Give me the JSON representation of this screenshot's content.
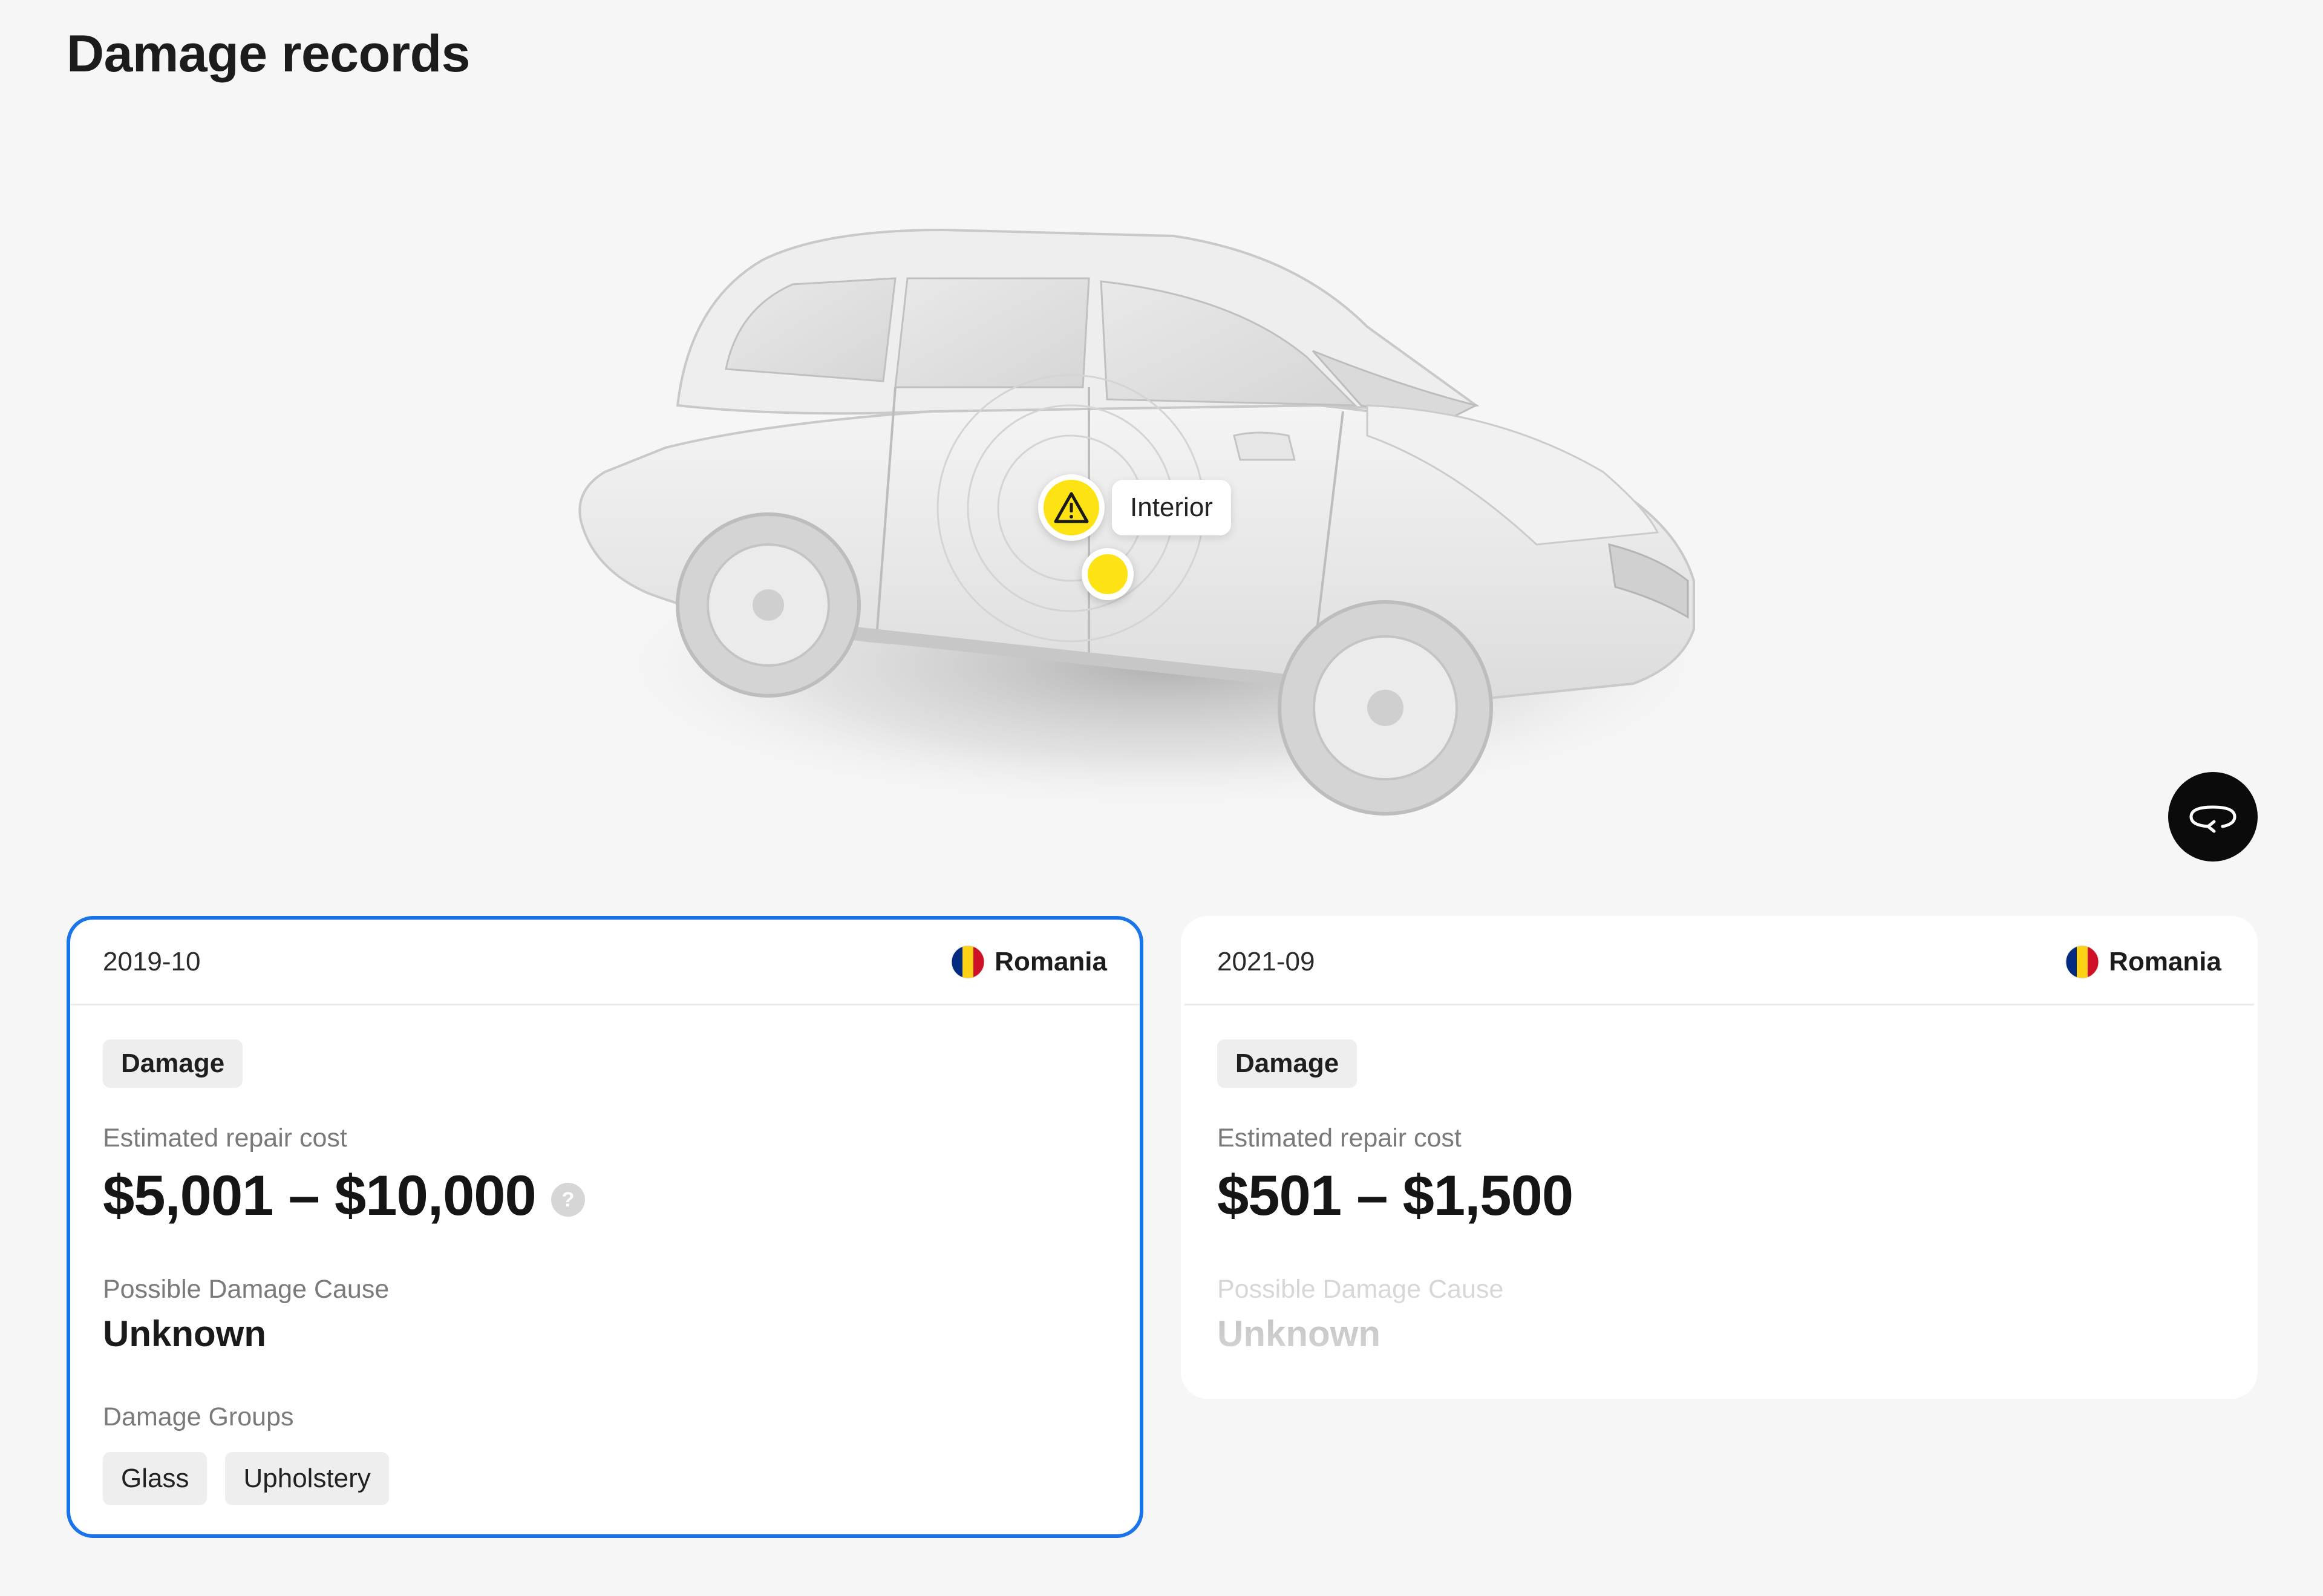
{
  "page": {
    "title": "Damage records"
  },
  "viewer": {
    "marker_label": "Interior",
    "rotate_icon": "rotate-360-icon",
    "warning_icon": "warning-triangle-icon",
    "accent_color": "#fde314"
  },
  "records": [
    {
      "date": "2019-10",
      "country": "Romania",
      "flag_icon": "romania-flag-icon",
      "type": "Damage",
      "cost_label": "Estimated repair cost",
      "cost_range": "$5,001 – $10,000",
      "cause_label": "Possible Damage Cause",
      "cause": "Unknown",
      "groups_label": "Damage Groups",
      "groups": [
        "Glass",
        "Upholstery"
      ],
      "selected": true,
      "border_color": "#1a73e8"
    },
    {
      "date": "2021-09",
      "country": "Romania",
      "flag_icon": "romania-flag-icon",
      "type": "Damage",
      "cost_label": "Estimated repair cost",
      "cost_range": "$501 – $1,500",
      "cause_label": "Possible Damage Cause",
      "cause": "Unknown",
      "selected": false
    }
  ]
}
